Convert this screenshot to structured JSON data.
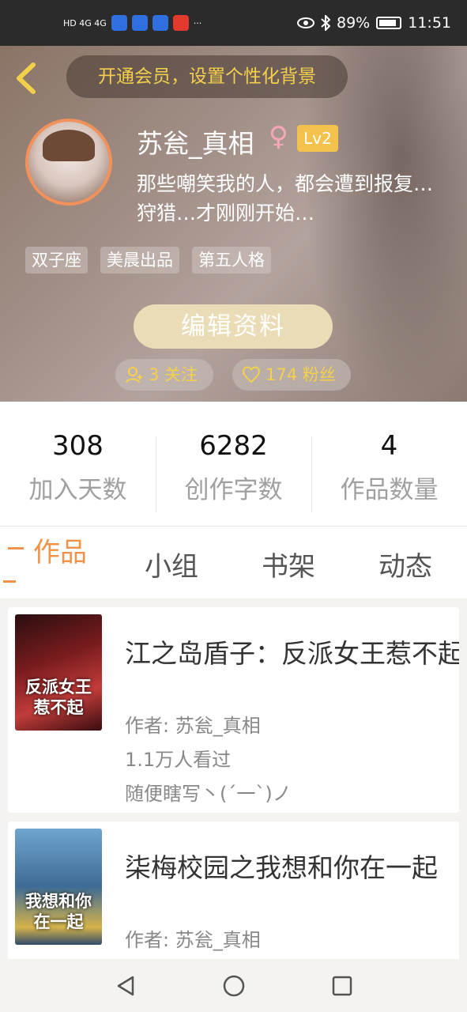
{
  "status_bar": {
    "network": "HD 4G 4G",
    "battery": "89%",
    "time": "11:51",
    "more": "···"
  },
  "header": {
    "vip_banner": "开通会员，设置个性化背景",
    "username": "苏瓮_真相",
    "gender_symbol": "♀",
    "level": "Lv2",
    "bio": "那些嘲笑我的人，都会遭到报复…狩猎…才刚刚开始…",
    "tags": [
      "双子座",
      "美晨出品",
      "第五人格"
    ],
    "edit_button": "编辑资料",
    "following": "3 关注",
    "followers": "174 粉丝"
  },
  "stats": [
    {
      "value": "308",
      "label": "加入天数"
    },
    {
      "value": "6282",
      "label": "创作字数"
    },
    {
      "value": "4",
      "label": "作品数量"
    }
  ],
  "tabs": [
    "作品",
    "小组",
    "书架",
    "动态"
  ],
  "works": [
    {
      "title": "江之岛盾子：反派女王惹不起",
      "cover_text": "反派女王惹不起",
      "author": "作者: 苏瓮_真相",
      "views": "1.1万人看过",
      "desc": "随便瞎写丶(ˊ一ˋ)ノ"
    },
    {
      "title": "柒梅校园之我想和你在一起",
      "cover_text": "我想和你在一起",
      "author": "作者: 苏瓮_真相"
    }
  ],
  "colors": {
    "accent": "#f0934a",
    "gold": "#f4d04c",
    "level_badge": "#f3c24c",
    "edit_button": "#eadcb6"
  },
  "icons": [
    "back-chevron-icon",
    "eye-icon",
    "bluetooth-icon",
    "battery-icon",
    "follow-user-icon",
    "heart-icon",
    "nav-back-icon",
    "nav-home-icon",
    "nav-recents-icon"
  ]
}
